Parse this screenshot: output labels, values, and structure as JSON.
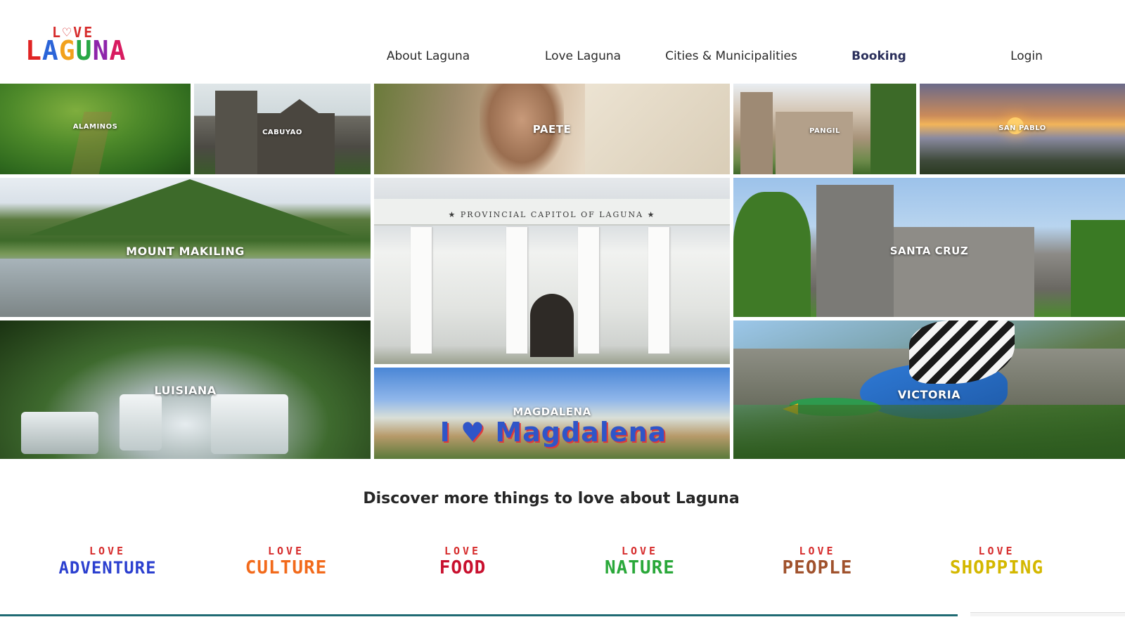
{
  "brand": {
    "love": "LOVE",
    "name": "LAGUNA",
    "love_colors": [
      "#d62c2c",
      "#2f6fd6",
      "#d62c2c",
      "#d62c2c"
    ],
    "name_colors": [
      "#e02424",
      "#2b64d8",
      "#f2a11c",
      "#28a745",
      "#8e24aa",
      "#d81b60"
    ]
  },
  "nav": {
    "items": [
      {
        "label": "About Laguna",
        "active": false
      },
      {
        "label": "Love Laguna",
        "active": false
      },
      {
        "label": "Cities & Municipalities",
        "active": false
      },
      {
        "label": "Booking",
        "active": true
      },
      {
        "label": "Login",
        "active": false
      }
    ]
  },
  "mosaic": {
    "tiles": [
      {
        "label": "ALAMINOS"
      },
      {
        "label": "CABUYAO"
      },
      {
        "label": "PAETE"
      },
      {
        "label": "PANGIL"
      },
      {
        "label": "SAN PABLO"
      },
      {
        "label": "MOUNT MAKILING"
      },
      {
        "label": "SANTA CRUZ"
      },
      {
        "label": "LUISIANA"
      },
      {
        "label": "MAGDALENA"
      },
      {
        "label": "VICTORIA"
      }
    ],
    "capitol_sign": "★ PROVINCIAL CAPITOL OF LAGUNA ★",
    "magdalena_sign": "I ♥ Magdalena"
  },
  "discover": {
    "title": "Discover more things to love about Laguna",
    "categories": [
      {
        "love": "LOVE",
        "word": "ADVENTURE",
        "color": "#2b3fcf"
      },
      {
        "love": "LOVE",
        "word": "CULTURE",
        "color": "#f26a1b"
      },
      {
        "love": "LOVE",
        "word": "FOOD",
        "color": "#c8102e"
      },
      {
        "love": "LOVE",
        "word": "NATURE",
        "color": "#2aa83a"
      },
      {
        "love": "LOVE",
        "word": "PEOPLE",
        "color": "#a0522d"
      },
      {
        "love": "LOVE",
        "word": "SHOPPING",
        "color": "#d4b800"
      }
    ]
  },
  "colors": {
    "nav_active": "#2a2f5b",
    "footer_line": "#1f6a73"
  }
}
